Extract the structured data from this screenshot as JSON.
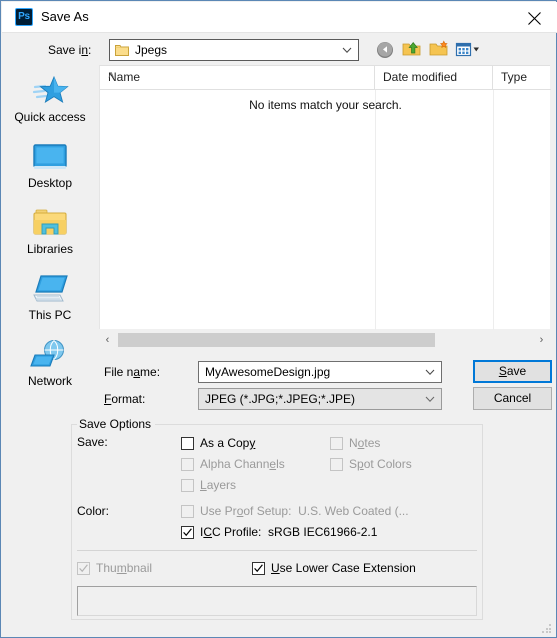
{
  "window": {
    "title": "Save As",
    "app_icon": "photoshop-ps-icon",
    "close_label": "✕"
  },
  "savein": {
    "label": "Save in:",
    "value": "Jpegs",
    "icon": "folder-icon",
    "toolbar": [
      {
        "name": "back-button",
        "icon": "back-arrow-icon"
      },
      {
        "name": "up-one-level-button",
        "icon": "up-folder-icon"
      },
      {
        "name": "new-folder-button",
        "icon": "new-folder-icon"
      },
      {
        "name": "views-button",
        "icon": "views-icon"
      }
    ]
  },
  "places": [
    {
      "label": "Quick access",
      "icon": "star-icon"
    },
    {
      "label": "Desktop",
      "icon": "monitor-icon"
    },
    {
      "label": "Libraries",
      "icon": "libraries-folder-icon"
    },
    {
      "label": "This PC",
      "icon": "computer-icon"
    },
    {
      "label": "Network",
      "icon": "network-globe-icon"
    }
  ],
  "filelist": {
    "columns": [
      "Name",
      "Date modified",
      "Type"
    ],
    "sort_indicator": "˄",
    "empty_message": "No items match your search.",
    "rows": []
  },
  "scrollbar": {
    "left_arrow": "‹",
    "right_arrow": "›"
  },
  "filename": {
    "label_pre": "File n",
    "label_key": "a",
    "label_post": "me:",
    "value": "MyAwesomeDesign.jpg"
  },
  "format": {
    "label_key": "F",
    "label_post": "ormat:",
    "value": "JPEG (*.JPG;*.JPEG;*.JPE)"
  },
  "buttons": {
    "save_key": "S",
    "save_post": "ave",
    "cancel": "Cancel"
  },
  "save_options": {
    "group_title": "Save Options",
    "save_row_label": "Save:",
    "color_row_label": "Color:",
    "checkboxes": [
      {
        "name": "as-a-copy-checkbox",
        "label_pre": "As a Cop",
        "label_key": "y",
        "label_post": "",
        "checked": false,
        "enabled": true
      },
      {
        "name": "alpha-channels-checkbox",
        "label_pre": "Alpha Chann",
        "label_key": "e",
        "label_post": "ls",
        "checked": false,
        "enabled": false
      },
      {
        "name": "layers-checkbox",
        "label_pre": "",
        "label_key": "L",
        "label_post": "ayers",
        "checked": false,
        "enabled": false
      },
      {
        "name": "notes-checkbox",
        "label_pre": "N",
        "label_key": "o",
        "label_post": "tes",
        "checked": false,
        "enabled": false
      },
      {
        "name": "spot-colors-checkbox",
        "label_pre": "S",
        "label_key": "p",
        "label_post": "ot Colors",
        "checked": false,
        "enabled": false
      },
      {
        "name": "use-proof-setup-checkbox",
        "label_pre": "Use Pr",
        "label_key": "o",
        "label_post": "of Setup:  U.S. Web Coated (...",
        "checked": false,
        "enabled": false
      },
      {
        "name": "icc-profile-checkbox",
        "label_pre": "I",
        "label_key": "C",
        "label_post": "C Profile:  sRGB IEC61966-2.1",
        "checked": true,
        "enabled": true
      },
      {
        "name": "thumbnail-checkbox",
        "label_pre": "Thu",
        "label_key": "m",
        "label_post": "bnail",
        "checked": true,
        "enabled": false
      },
      {
        "name": "use-lower-case-extension-checkbox",
        "label_pre": "",
        "label_key": "U",
        "label_post": "se Lower Case Extension",
        "checked": true,
        "enabled": true
      }
    ]
  },
  "colors": {
    "accent": "#0078d7",
    "window_border": "#5b87b5",
    "dialog_bg": "#f0f0f0",
    "list_bg": "#ffffff",
    "disabled_text": "#9a9a9a",
    "scroll_thumb": "#cdcdcd"
  }
}
